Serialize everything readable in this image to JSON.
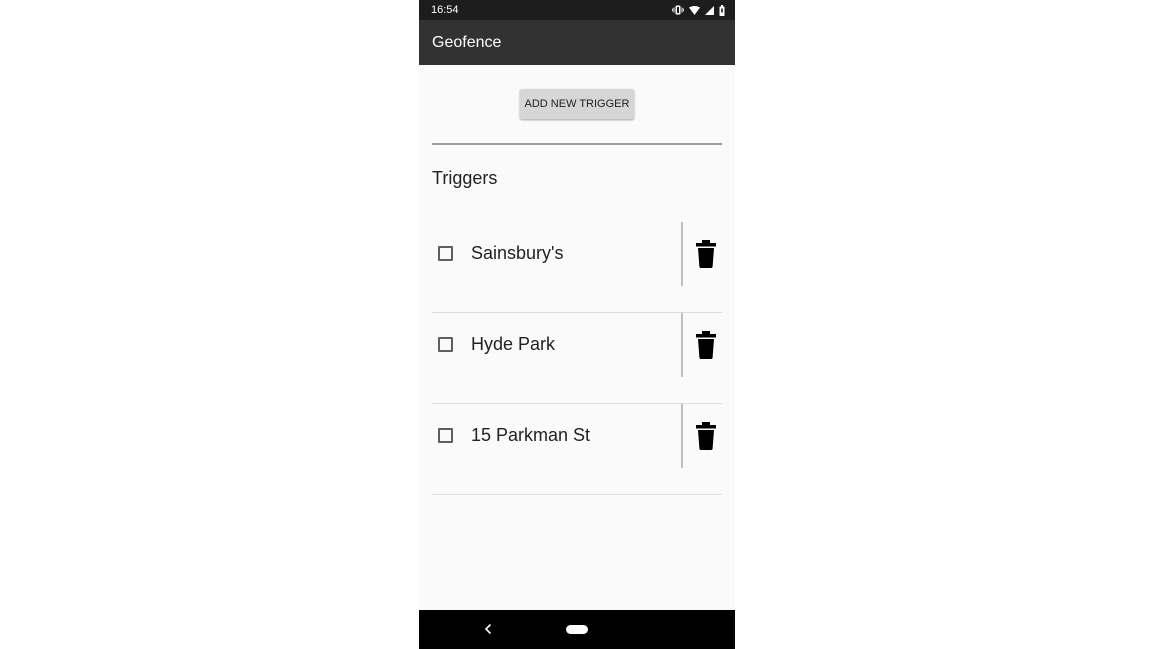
{
  "status_bar": {
    "time": "16:54",
    "icons": [
      "vibrate-icon",
      "wifi-icon",
      "signal-icon",
      "battery-icon"
    ]
  },
  "app_bar": {
    "title": "Geofence"
  },
  "main": {
    "add_button_label": "ADD NEW TRIGGER",
    "section_title": "Triggers",
    "triggers": [
      {
        "label": "Sainsbury's",
        "checked": false
      },
      {
        "label": "Hyde Park",
        "checked": false
      },
      {
        "label": "15 Parkman St",
        "checked": false
      }
    ]
  },
  "nav_bar": {
    "icons": [
      "back-icon",
      "home-icon"
    ]
  },
  "colors": {
    "status_bar": "#1d1d1d",
    "app_bar": "#323232",
    "background": "#fafafa",
    "button": "#d6d6d6",
    "nav_bar": "#000000"
  }
}
